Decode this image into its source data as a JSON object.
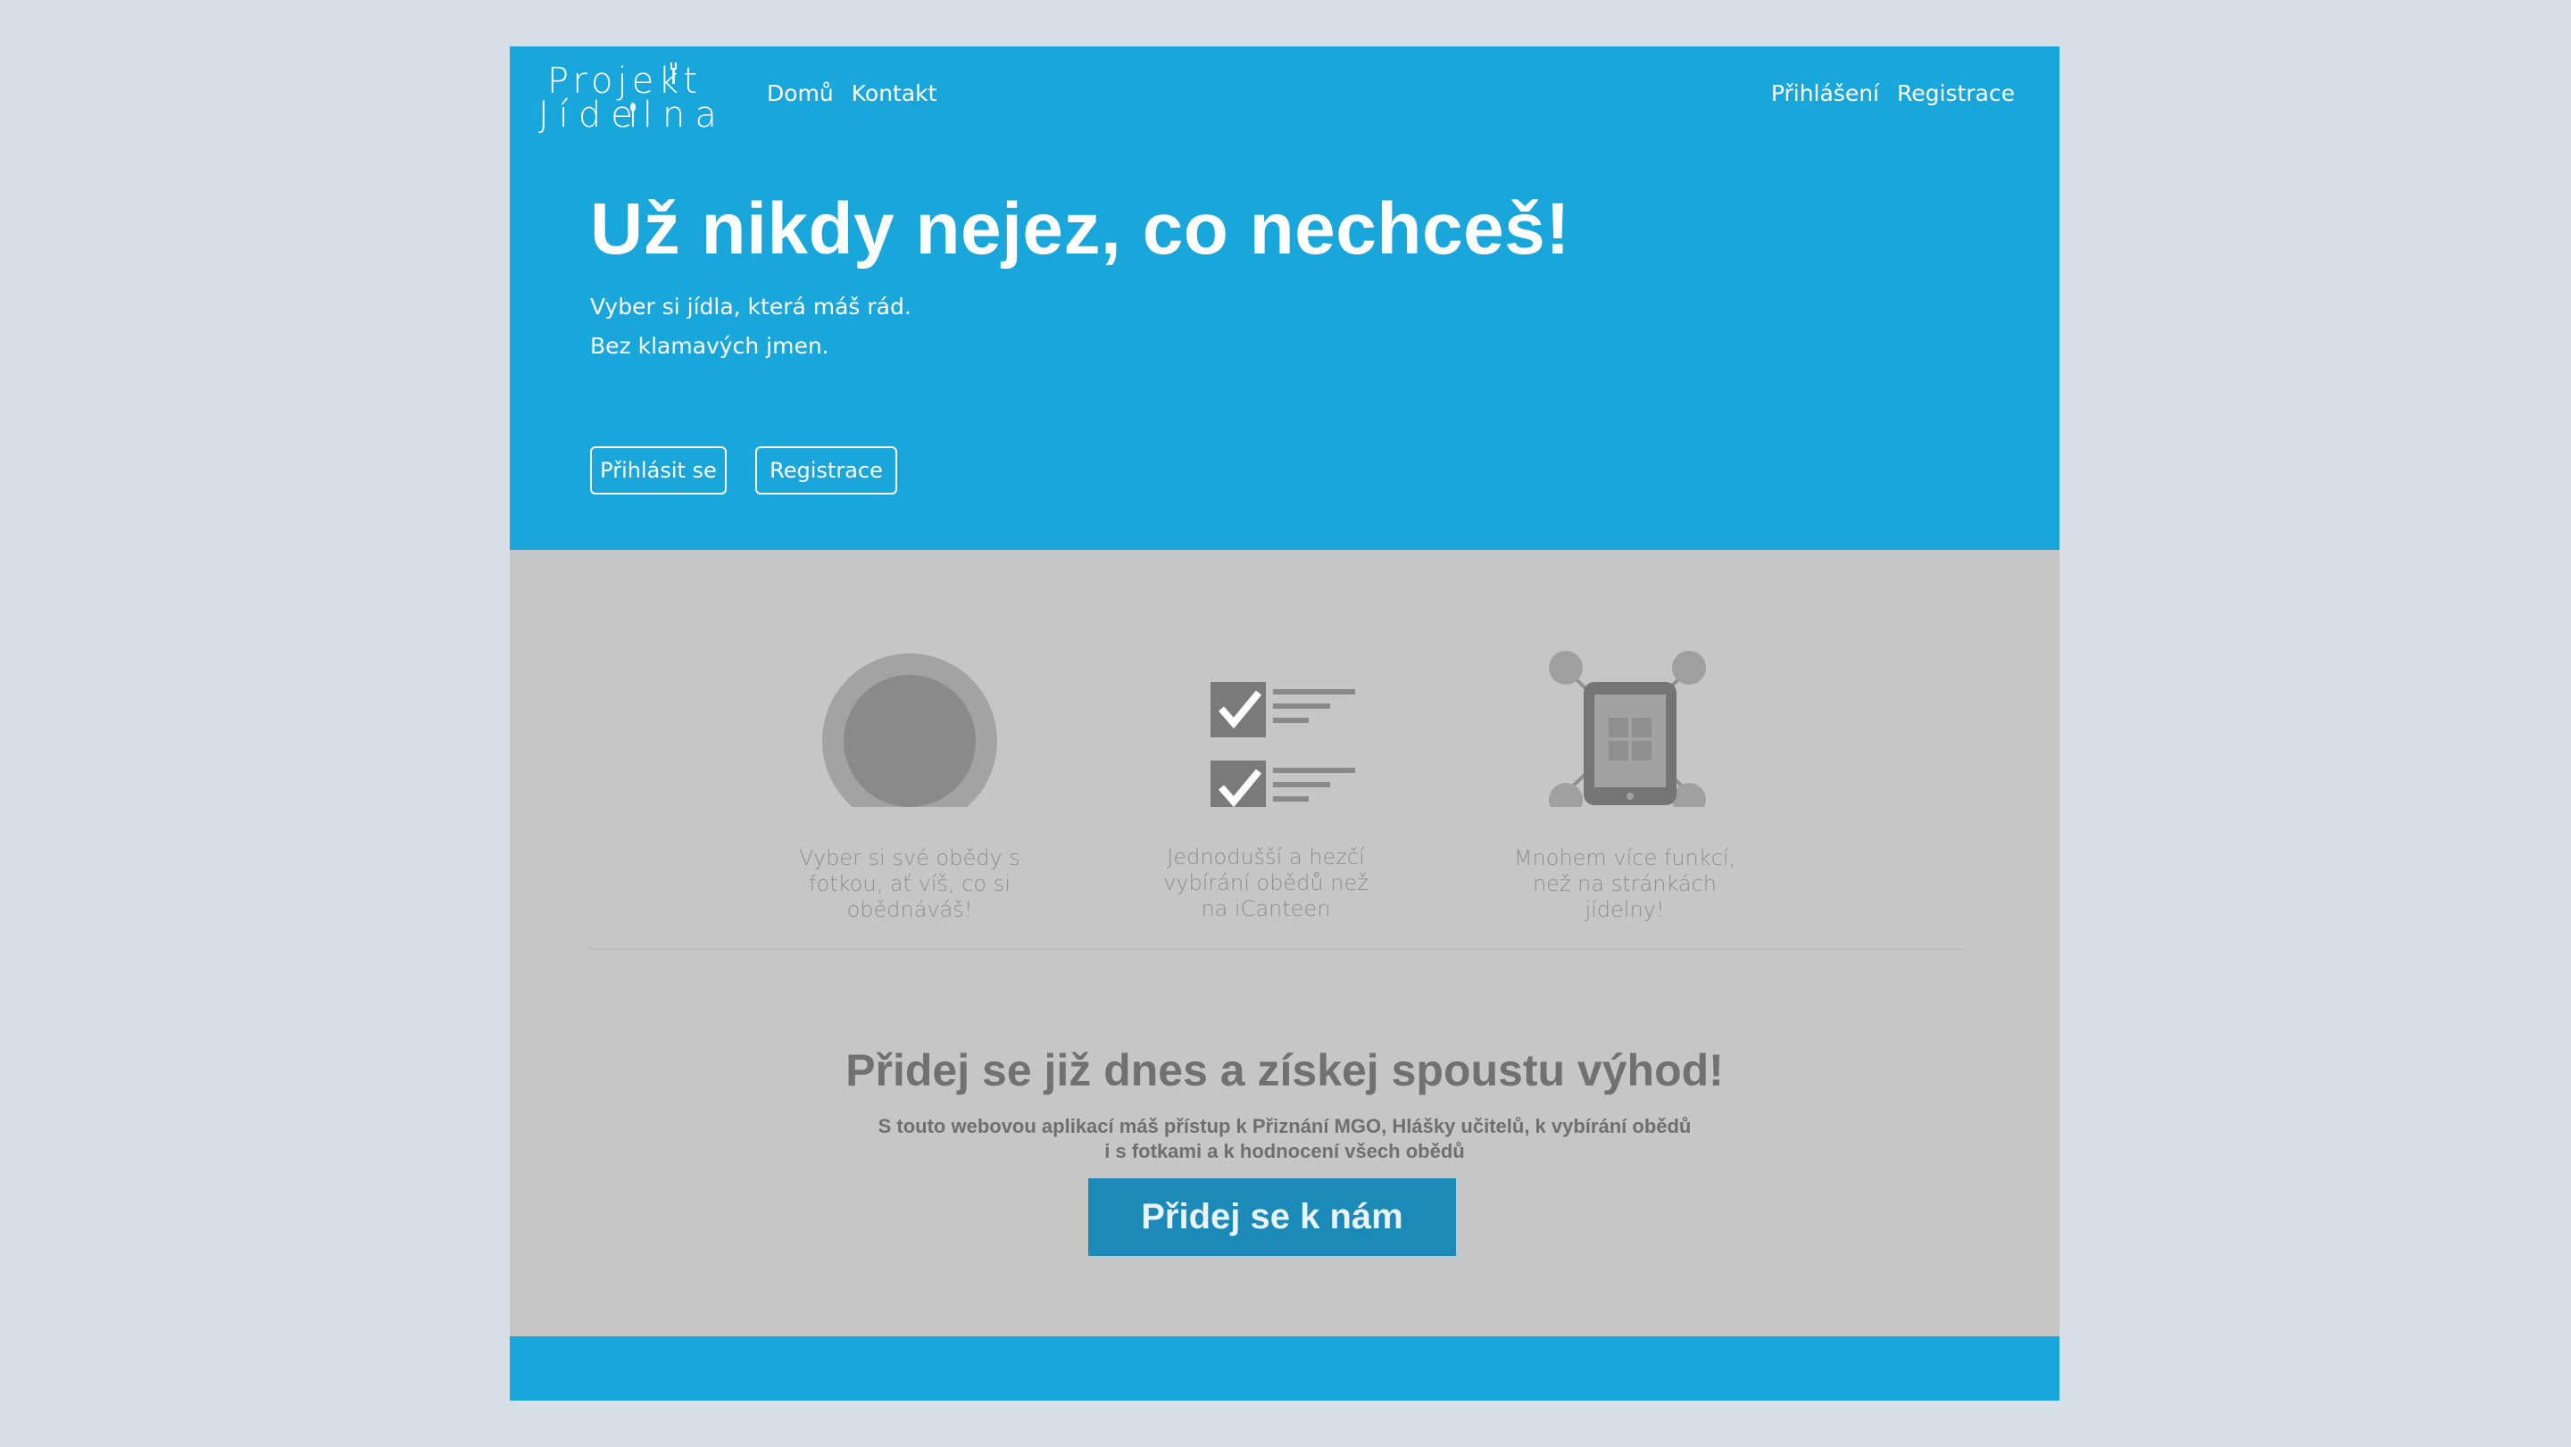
{
  "logo": {
    "line1": "Projekt",
    "line2": "Jídelna"
  },
  "nav": {
    "left": [
      "Domů",
      "Kontakt"
    ],
    "right": [
      "Přihlášení",
      "Registrace"
    ]
  },
  "hero": {
    "title": "Už nikdy nejez, co nechceš!",
    "subtitle_line1": "Vyber si jídla, která máš rád.",
    "subtitle_line2": "Bez klamavých jmen.",
    "login_button": "Přihlásit se",
    "register_button": "Registrace"
  },
  "features": [
    {
      "icon": "plate-icon",
      "text_lines": [
        "Vyber si své obědy s",
        "fotkou, ať víš, co si",
        "obědnáváš!"
      ]
    },
    {
      "icon": "checklist-icon",
      "text_lines": [
        "Jednodušší a hezčí",
        "vybírání obědů než",
        "na iCanteen"
      ]
    },
    {
      "icon": "tablet-network-icon",
      "text_lines": [
        "Mnohem více funkcí,",
        "než na stránkách",
        "jídelny!"
      ]
    }
  ],
  "join": {
    "title": "Přidej se již dnes a získej spoustu výhod!",
    "text_line1": "S touto webovou aplikací máš přístup k Přiznání MGO, Hlášky učitelů, k vybírání obědů",
    "text_line2": "i s fotkami a k hodnocení všech obědů",
    "button": "Přidej se k nám"
  },
  "colors": {
    "primary": "#19a6db",
    "body_bg": "#c6c6c6",
    "page_bg": "#d7dee7",
    "join_button": "#1b8ab8"
  }
}
